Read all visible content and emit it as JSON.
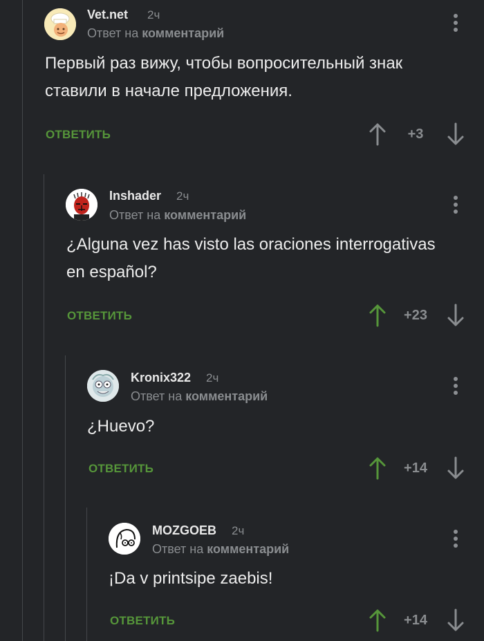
{
  "comments": [
    {
      "author": "Vet.net",
      "time": "2ч",
      "reply_prefix": "Ответ на",
      "reply_link": "комментарий",
      "text": "Первый раз вижу, чтобы вопросительный знак ставили в начале предложения.",
      "reply_label": "ОТВЕТИТЬ",
      "rating": "+3",
      "avatar_icon": "chef-avatar-icon",
      "up_color": "#8a8d90"
    },
    {
      "author": "Inshader",
      "time": "2ч",
      "reply_prefix": "Ответ на",
      "reply_link": "комментарий",
      "text": "¿Alguna vez has visto las oraciones interrogativas en español?",
      "reply_label": "ОТВЕТИТЬ",
      "rating": "+23",
      "avatar_icon": "sith-avatar-icon",
      "up_color": "#56963a"
    },
    {
      "author": "Kronix322",
      "time": "2ч",
      "reply_prefix": "Ответ на",
      "reply_link": "комментарий",
      "text": "¿Huevo?",
      "reply_label": "ОТВЕТИТЬ",
      "rating": "+14",
      "avatar_icon": "morty-avatar-icon",
      "up_color": "#56963a"
    },
    {
      "author": "MOZGOEB",
      "time": "2ч",
      "reply_prefix": "Ответ на",
      "reply_link": "комментарий",
      "text": "¡Da v printsipe zaebis!",
      "reply_label": "ОТВЕТИТЬ",
      "rating": "+14",
      "avatar_icon": "glasses-face-avatar-icon",
      "up_color": "#56963a"
    }
  ],
  "colors": {
    "background": "#232528",
    "reply_green": "#56963a",
    "muted": "#8a8d90",
    "thread_line": "#44474b"
  }
}
